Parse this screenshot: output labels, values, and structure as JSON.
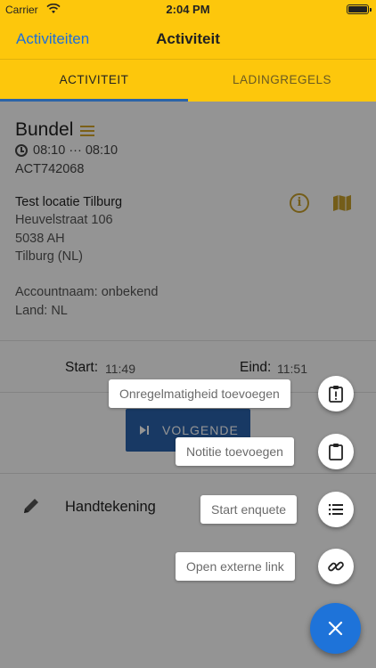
{
  "status_bar": {
    "carrier": "Carrier",
    "time": "2:04 PM"
  },
  "nav": {
    "back_label": "Activiteiten",
    "title": "Activiteit"
  },
  "tabs": [
    {
      "label": "ACTIVITEIT",
      "active": true
    },
    {
      "label": "LADINGREGELS",
      "active": false
    }
  ],
  "activity": {
    "title": "Bundel",
    "time_range": "08:10 ··· 08:10",
    "code": "ACT742068"
  },
  "location": {
    "name": "Test locatie Tilburg",
    "street": "Heuvelstraat 106",
    "postal": "5038 AH",
    "city": "Tilburg (NL)",
    "account": "Accountnaam: onbekend",
    "country": "Land: NL"
  },
  "times": {
    "start_label": "Start:",
    "start_value": "11:49",
    "end_label": "Eind:",
    "end_value": "11:51"
  },
  "next_button": {
    "label": "VOLGENDE"
  },
  "signature": {
    "label": "Handtekening"
  },
  "fab_menu": [
    {
      "label": "Onregelmatigheid toevoegen",
      "icon": "clipboard-alert-icon"
    },
    {
      "label": "Notitie toevoegen",
      "icon": "clipboard-icon"
    },
    {
      "label": "Start enquete",
      "icon": "list-icon"
    },
    {
      "label": "Open externe link",
      "icon": "link-icon"
    }
  ],
  "colors": {
    "accent": "#fdc70c",
    "primary": "#2a63ad",
    "fab": "#1e73d9",
    "icon_gold": "#c9a02c"
  }
}
